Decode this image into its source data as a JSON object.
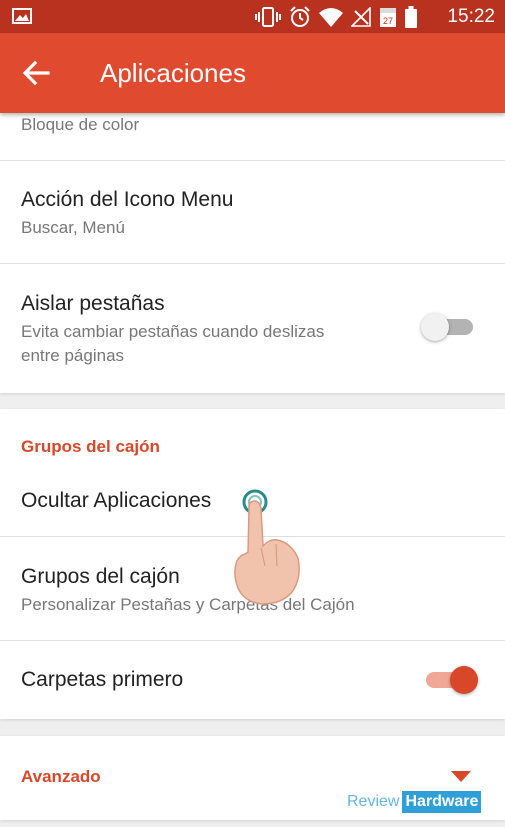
{
  "status_bar": {
    "time": "15:22",
    "icons": [
      "image-icon",
      "vibrate-icon",
      "alarm-icon",
      "wifi-icon",
      "no-signal-icon",
      "calendar-icon",
      "battery-icon"
    ],
    "calendar_day": "27",
    "background": "#b8321f"
  },
  "app_bar": {
    "title": "Aplicaciones",
    "back_icon": "arrow-back-icon",
    "background": "#e04a2f"
  },
  "colors": {
    "accent": "#d9472b",
    "accent_track": "#f0a796",
    "toggle_off_track": "#b3b3b3"
  },
  "card1": {
    "rows": [
      {
        "subtitle": "Bloque de color"
      },
      {
        "title": "Acción del Icono Menu",
        "subtitle": "Buscar, Menú"
      },
      {
        "title": "Aislar pestañas",
        "subtitle_line1": "Evita cambiar pestañas cuando deslizas",
        "subtitle_line2": "entre páginas",
        "toggle": false
      }
    ]
  },
  "card2": {
    "header": "Grupos del cajón",
    "rows": [
      {
        "title": "Ocultar Aplicaciones"
      },
      {
        "title": "Grupos del cajón",
        "subtitle": "Personalizar Pestañas y Carpetas del Cajón"
      },
      {
        "title": "Carpetas primero",
        "toggle": true
      }
    ]
  },
  "card3": {
    "header": "Avanzado",
    "expand_icon": "triangle-down-icon"
  },
  "watermark": {
    "part1": "Review",
    "part2": "Hardware"
  }
}
